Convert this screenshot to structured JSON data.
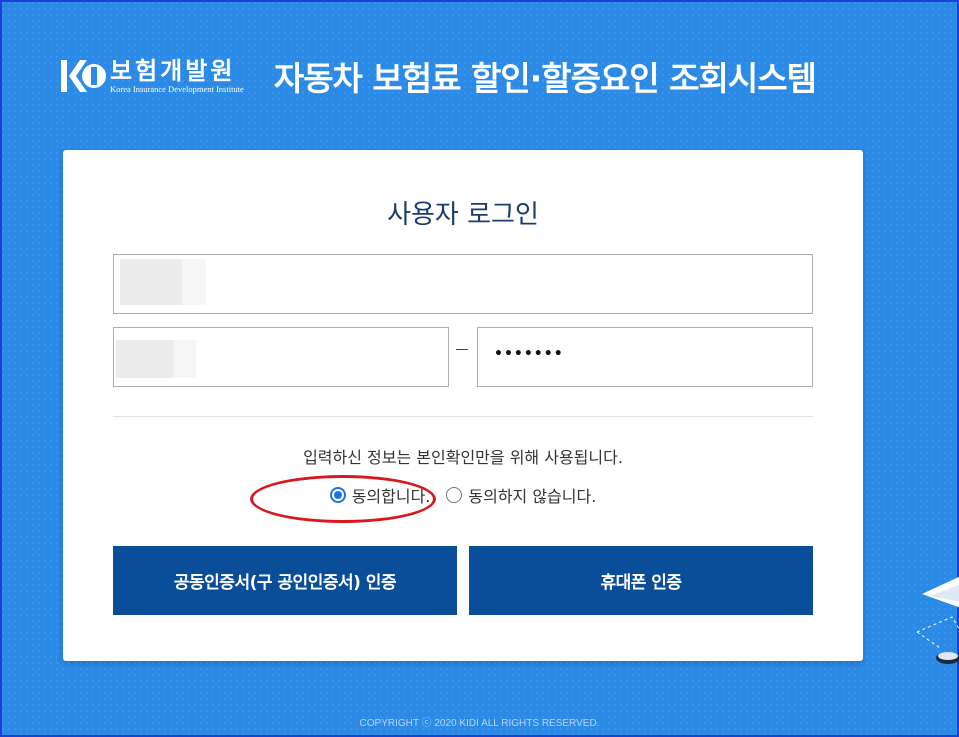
{
  "header": {
    "logo_korean": "보험개발원",
    "logo_english": "Korea Insurance Development Institute",
    "title": "자동차 보험료 할인·할증요인 조회시스템"
  },
  "login": {
    "title": "사용자 로그인",
    "name_value": "",
    "rrn_front_value": "",
    "rrn_back_masked": "•••••••",
    "notice": "입력하신 정보는 본인확인만을 위해 사용됩니다.",
    "agree_label": "동의합니다.",
    "disagree_label": "동의하지 않습니다.",
    "agree_selected": true,
    "cert_button": "공동인증서(구 공인인증서) 인증",
    "phone_button": "휴대폰 인증"
  },
  "footer": {
    "copyright": "COPYRIGHT ⓒ 2020 KIDI ALL RIGHTS RESERVED."
  },
  "colors": {
    "background": "#2a8ae6",
    "button": "#0a4d99",
    "title_text": "#1a3c6e",
    "highlight": "#d7191f",
    "radio_accent": "#1a73e8"
  },
  "icons": {
    "logo": "kidi-logo-icon",
    "decoration": "airplane-icon"
  }
}
